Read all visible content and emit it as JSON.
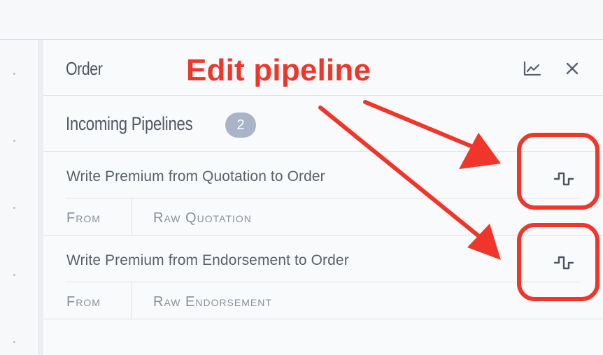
{
  "panel": {
    "title": "Order",
    "section_title": "Incoming Pipelines",
    "pipeline_count": "2",
    "pipelines": [
      {
        "name": "Write Premium from Quotation to Order",
        "from_label": "From",
        "source": "Raw Quotation"
      },
      {
        "name": "Write Premium from Endorsement to Order",
        "from_label": "From",
        "source": "Raw Endorsement"
      }
    ]
  },
  "icons": {
    "chart": "chart-line-icon",
    "close": "close-icon",
    "edit_pipeline": "pipeline-wave-icon"
  },
  "annotation": {
    "label": "Edit pipeline",
    "color": "#f0362a"
  }
}
